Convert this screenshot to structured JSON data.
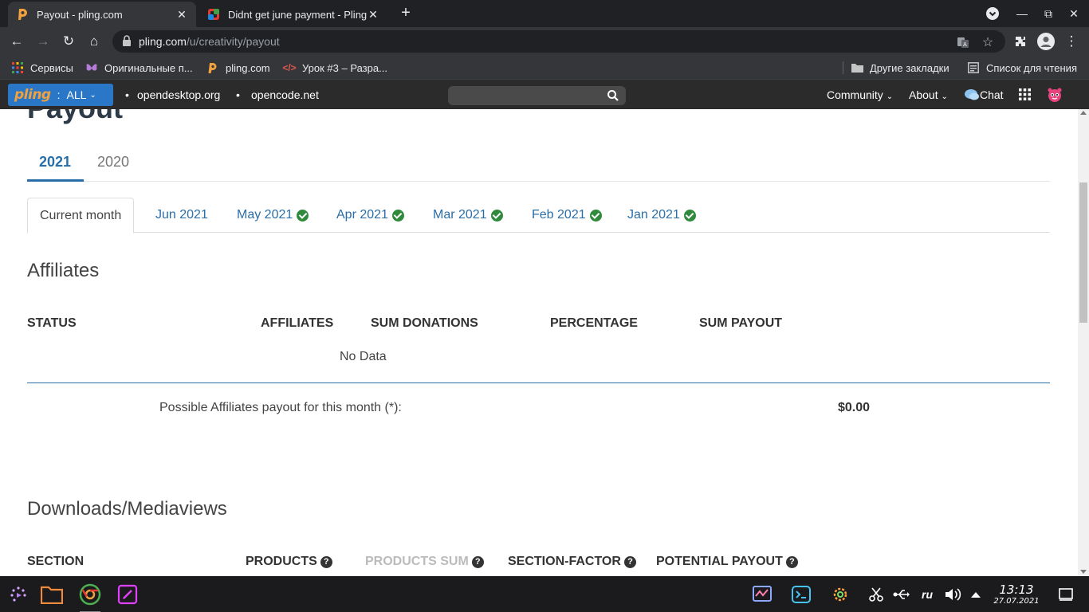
{
  "browser": {
    "tabs": [
      {
        "title": "Payout - pling.com",
        "active": true
      },
      {
        "title": "Didnt get june payment - Pling",
        "active": false
      }
    ],
    "url_host": "pling.com",
    "url_path": "/u/creativity/payout",
    "bookmarks": [
      {
        "label": "Сервисы",
        "icon": "apps-grid-icon"
      },
      {
        "label": "Оригинальные п...",
        "icon": "butterfly-icon"
      },
      {
        "label": "pling.com",
        "icon": "pling-icon"
      },
      {
        "label": "Урок #3 – Разра...",
        "icon": "code-icon"
      }
    ],
    "bookmarks_right": [
      {
        "label": "Другие закладки",
        "icon": "folder-icon"
      },
      {
        "label": "Список для чтения",
        "icon": "reading-list-icon"
      }
    ]
  },
  "site_header": {
    "logo": "pling",
    "colon": ":",
    "all_label": "ALL",
    "links": [
      "opendesktop.org",
      "opencode.net"
    ],
    "search_placeholder": "",
    "community_label": "Community",
    "about_label": "About",
    "chat_label": "Chat"
  },
  "page": {
    "title": "Payout",
    "years": [
      "2021",
      "2020"
    ],
    "active_year": "2021",
    "months": [
      {
        "label": "Current month",
        "paid": false
      },
      {
        "label": "Jun 2021",
        "paid": false
      },
      {
        "label": "May 2021",
        "paid": true
      },
      {
        "label": "Apr 2021",
        "paid": true
      },
      {
        "label": "Mar 2021",
        "paid": true
      },
      {
        "label": "Feb 2021",
        "paid": true
      },
      {
        "label": "Jan 2021",
        "paid": true
      }
    ],
    "affiliates": {
      "title": "Affiliates",
      "columns": [
        "STATUS",
        "AFFILIATES",
        "SUM DONATIONS",
        "PERCENTAGE",
        "SUM PAYOUT"
      ],
      "empty_text": "No Data",
      "payout_label": "Possible Affiliates payout for this month (*):",
      "payout_value": "$0.00"
    },
    "downloads": {
      "title": "Downloads/Mediaviews",
      "columns": [
        "SECTION",
        "PRODUCTS",
        "PRODUCTS SUM",
        "SECTION-FACTOR",
        "POTENTIAL PAYOUT"
      ]
    }
  },
  "taskbar": {
    "time": "13:13",
    "date": "27.07.2021",
    "lang": "ru"
  },
  "colors": {
    "accent": "#2a6ea8",
    "check_green": "#2f8a3c",
    "header_bg": "#2b2b2b"
  }
}
